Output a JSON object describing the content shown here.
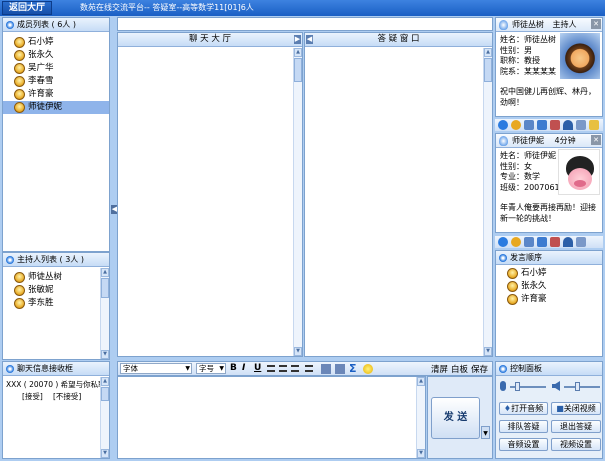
{
  "titlebar": {
    "back_label": "返回大厅",
    "title": "数苑在线交流平台-- 答疑室--高等数学11[01]6人"
  },
  "members": {
    "title": "成员列表 ( 6人 )",
    "items": [
      "石小婷",
      "张永久",
      "吴广华",
      "李春雪",
      "许育豪",
      "师徒伊妮"
    ],
    "selected_index": 5
  },
  "hosts": {
    "title": "主持人列表 ( 3人 )",
    "items": [
      "师徒丛树",
      "张敏妮",
      "李东胜"
    ]
  },
  "chat_box": {
    "title": "聊天信息接收框",
    "message": "XXX ( 20070 ) 希望与你私聊",
    "accept_label": "[接受]",
    "reject_label": "[不接受]"
  },
  "chat_hall": {
    "title": "聊 天 大 厅"
  },
  "qa_window": {
    "title": "答 疑 窗 口"
  },
  "toolbar": {
    "font_label": "字体",
    "size_label": "字号",
    "bold": "B",
    "italic": "I",
    "underline": "U",
    "clear_label": "清屏",
    "whiteboard_label": "白板",
    "save_label": "保存",
    "send_label": "发 送"
  },
  "host_card": {
    "name": "师徒丛树",
    "role": "主持人",
    "lines": [
      "姓名：师徒丛树",
      "性别：男",
      "职称：教授",
      "院系：某某某某"
    ],
    "message": "祝中国健儿再创辉、林丹，劲啊！"
  },
  "user_card": {
    "name": "师徒伊妮",
    "time": "4分钟",
    "lines": [
      "姓名：师徒伊妮",
      "性别：女",
      "专业：数学",
      "班级：2007061"
    ],
    "message": "年青人俺要再接再励！迎接新一轮的挑战！"
  },
  "speak_order": {
    "title": "发言顺序",
    "items": [
      "石小婷",
      "张永久",
      "许育豪"
    ]
  },
  "control": {
    "title": "控制面板",
    "open_audio": "打开音频",
    "close_video": "关闭视频",
    "queue_answer": "排队答疑",
    "exit_answer": "退出答疑",
    "audio_settings": "音频设置",
    "video_settings": "视频设置",
    "mic_level": 0.15,
    "volume_level": 0.35
  },
  "colors": {
    "accent": "#2a7be0",
    "frame": "#aecdf1"
  }
}
